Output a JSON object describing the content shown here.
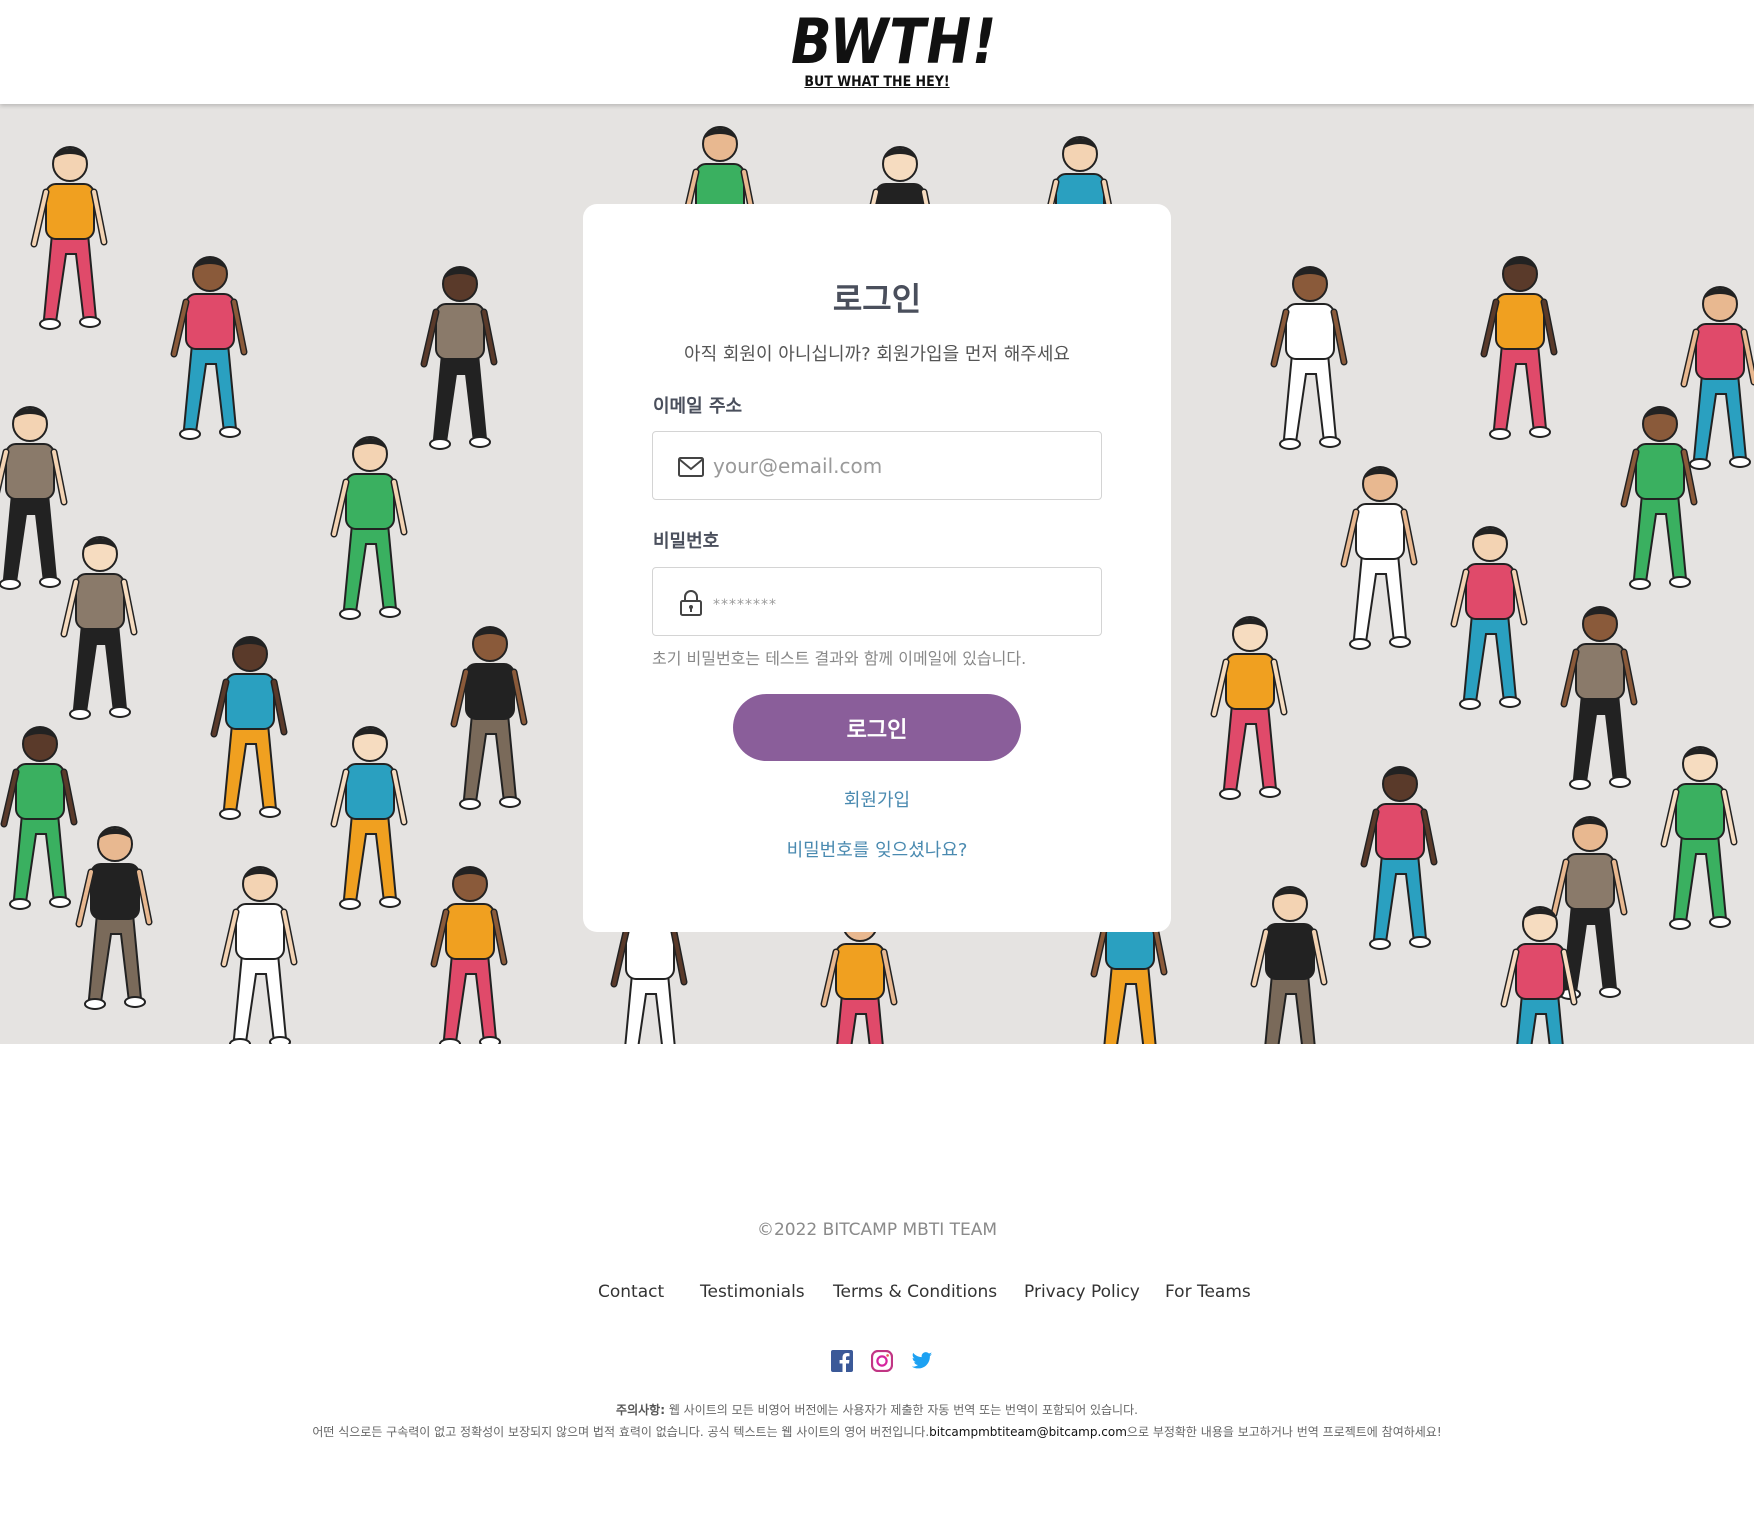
{
  "header": {
    "logo_text": "BWTH!",
    "logo_tagline": "BUT WHAT THE HEY!"
  },
  "login": {
    "title": "로그인",
    "subtitle": "아직 회원이 아니십니까? 회원가입을 먼저 해주세요",
    "email_label": "이메일 주소",
    "email_placeholder": "your@email.com",
    "password_label": "비밀번호",
    "password_placeholder": "********",
    "password_hint": "초기 비밀번호는 테스트 결과와 함께 이메일에 있습니다.",
    "submit_label": "로그인",
    "signup_link": "회원가입",
    "forgot_link": "비밀번호를 잊으셨나요?",
    "icons": {
      "email": "mail-icon",
      "password": "lock-icon"
    }
  },
  "footer": {
    "copyright": "©2022 BITCAMP MBTI TEAM",
    "links": [
      "Contact",
      "Testimonials",
      "Terms & Conditions",
      "Privacy Policy",
      "For Teams"
    ],
    "social_icons": [
      "facebook-icon",
      "instagram-icon",
      "twitter-icon"
    ],
    "notice_label": "주의사항:",
    "notice_line1": "웹 사이트의 모든 비영어 버전에는 사용자가 제출한 자동 번역 또는 번역이 포함되어 있습니다.",
    "notice_line2_a": "어떤 식으로든 구속력이 없고 정확성이 보장되지 않으며 법적 효력이 없습니다. 공식 텍스트는 웹 사이트의 영어 버전입니다.",
    "notice_email": "bitcampmbtiteam@bitcamp.com",
    "notice_line2_b": "으로 부정확한 내용을 보고하거나 번역 프로젝트에 참여하세요!"
  },
  "colors": {
    "primary_button": "#8a5e9a",
    "link": "#4a8ab0",
    "hero_background": "#e5e3e1",
    "facebook": "#3b5998",
    "instagram": "#c13584",
    "twitter": "#1da1f2"
  }
}
